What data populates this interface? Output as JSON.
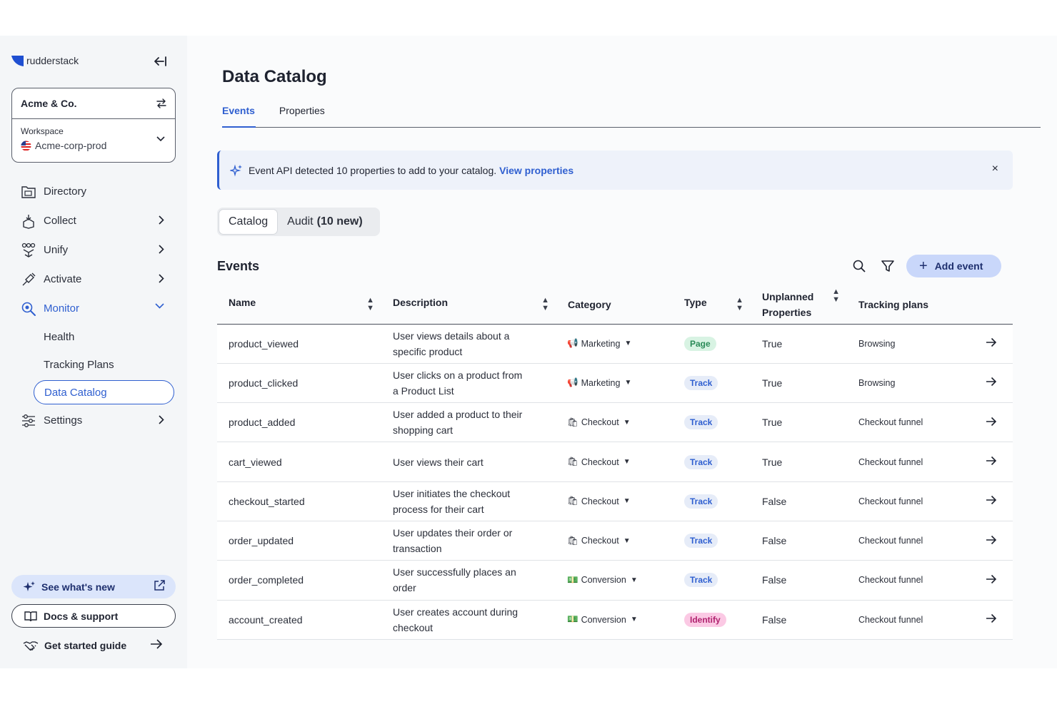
{
  "brand": {
    "name": "rudderstack",
    "color": "#1f4fd1"
  },
  "org": {
    "name": "Acme & Co.",
    "switch_icon": "swap-icon"
  },
  "workspace": {
    "label": "Workspace",
    "name": "Acme-corp-prod",
    "flag_icon": "us-flag-icon"
  },
  "nav": {
    "directory": "Directory",
    "collect": "Collect",
    "unify": "Unify",
    "activate": "Activate",
    "monitor": "Monitor",
    "monitor_sub": [
      "Health",
      "Tracking Plans",
      "Data Catalog"
    ],
    "settings": "Settings"
  },
  "footer": {
    "whats_new": "See what's new",
    "docs": "Docs & support",
    "guide": "Get started guide"
  },
  "page": {
    "title": "Data Catalog",
    "tabs": [
      "Events",
      "Properties"
    ],
    "active_tab": "Events"
  },
  "banner": {
    "text": "Event API detected 10 properties to add to your catalog.",
    "link": "View properties",
    "close": "×"
  },
  "segment": {
    "catalog": "Catalog",
    "audit": "Audit",
    "audit_count": "(10 new)"
  },
  "events": {
    "title": "Events",
    "add_label": "Add event",
    "add_plus": "+",
    "columns": [
      "Name",
      "Description",
      "Category",
      "Type",
      "Unplanned Properties",
      "Tracking plans"
    ],
    "column_unplanned_line1": "Unplanned",
    "column_unplanned_line2": "Properties",
    "rows": [
      {
        "name": "product_viewed",
        "desc": "User views details about a specific product",
        "category": "Marketing",
        "cat_icon": "📢",
        "type": "Page",
        "unplanned": "True",
        "plan": "Browsing"
      },
      {
        "name": "product_clicked",
        "desc": "User clicks on a product from a Product List",
        "category": "Marketing",
        "cat_icon": "📢",
        "type": "Track",
        "unplanned": "True",
        "plan": "Browsing"
      },
      {
        "name": "product_added",
        "desc": "User added a product to their shopping cart",
        "category": "Checkout",
        "cat_icon": "🛍",
        "type": "Track",
        "unplanned": "True",
        "plan": "Checkout funnel"
      },
      {
        "name": "cart_viewed",
        "desc": "User views their cart",
        "category": "Checkout",
        "cat_icon": "🛍",
        "type": "Track",
        "unplanned": "True",
        "plan": "Checkout funnel"
      },
      {
        "name": "checkout_started",
        "desc": "User initiates the checkout process for their cart",
        "category": "Checkout",
        "cat_icon": "🛍",
        "type": "Track",
        "unplanned": "False",
        "plan": "Checkout funnel"
      },
      {
        "name": "order_updated",
        "desc": "User updates their order or transaction",
        "category": "Checkout",
        "cat_icon": "🛍",
        "type": "Track",
        "unplanned": "False",
        "plan": "Checkout funnel"
      },
      {
        "name": "order_completed",
        "desc": "User successfully places an order",
        "category": "Conversion",
        "cat_icon": "💵",
        "type": "Track",
        "unplanned": "False",
        "plan": "Checkout funnel"
      },
      {
        "name": "account_created",
        "desc": "User creates account during checkout",
        "category": "Conversion",
        "cat_icon": "💵",
        "type": "Identify",
        "unplanned": "False",
        "plan": "Checkout funnel"
      }
    ]
  },
  "colors": {
    "accent": "#2f5fd0",
    "page_badge": "#d8f3e3",
    "track_badge": "#e6ecf8",
    "identify_badge": "#fbc9e4"
  }
}
